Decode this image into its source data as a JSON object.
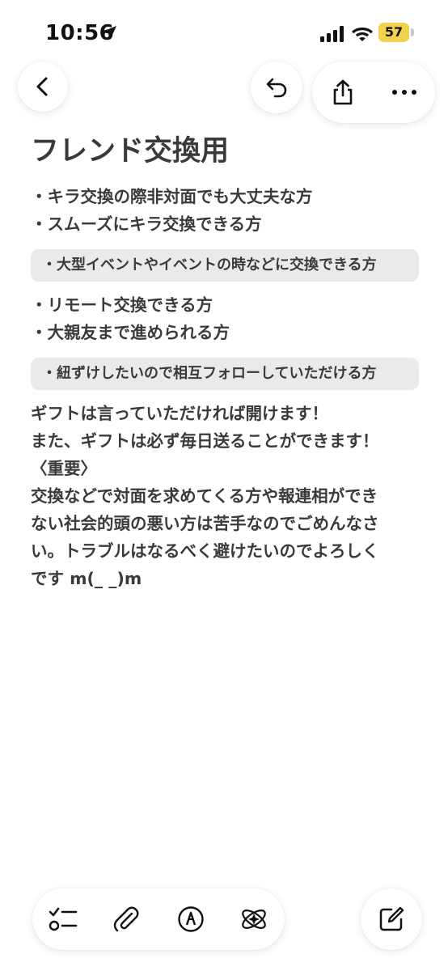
{
  "status_bar": {
    "time": "10:56",
    "battery": "57",
    "battery_color": "#f2d24a"
  },
  "toolbar": {
    "icons": [
      "chevron-left-icon",
      "undo-icon",
      "share-icon",
      "more-icon"
    ]
  },
  "note": {
    "title": "フレンド交換用",
    "bullets_1": [
      "・キラ交換の際非対面でも大丈夫な方",
      "・スムーズにキラ交換できる方"
    ],
    "quote_1": "・大型イベントやイベントの時などに交換できる方",
    "bullets_2": [
      "・リモート交換できる方",
      "・大親友まで進められる方"
    ],
    "quote_2": "・紐ずけしたいので相互フォローしていただける方",
    "paragraph_lines": [
      "ギフトは言っていただければ開けます！",
      "また、ギフトは必ず毎日送ることができます！",
      "〈重要〉",
      "交換などで対面を求めてくる方や報連相ができ",
      "ない社会的頭の悪い方は苦手なのでごめんなさ",
      "い。トラブルはなるべく避けたいのでよろしく",
      "です m(_ _)m"
    ]
  },
  "bottom_toolbar": {
    "icons": [
      "checklist-icon",
      "attachment-icon",
      "markup-icon",
      "writing-tools-icon",
      "compose-icon"
    ]
  },
  "colors": {
    "text": "#3a3a3c",
    "quote_bg": "#eaeaea",
    "background": "#ffffff"
  }
}
